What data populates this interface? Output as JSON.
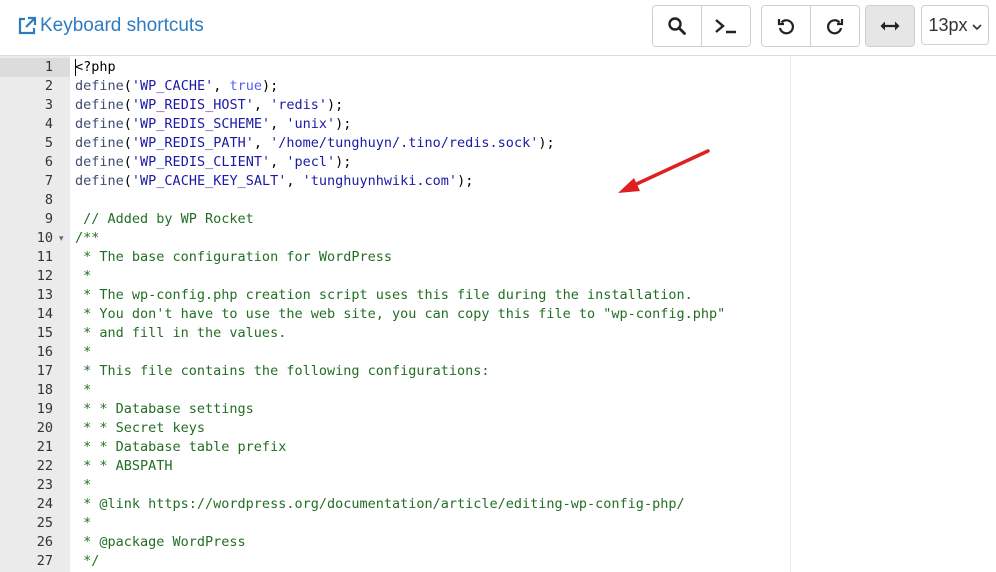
{
  "toolbar": {
    "keyboard_shortcuts_label": "Keyboard shortcuts",
    "font_size_value": "13px",
    "buttons": [
      "search-icon",
      "terminal-icon",
      "undo-icon",
      "redo-icon",
      "wrap-toggle-icon"
    ]
  },
  "colors": {
    "link": "#2e7bbf",
    "gutter_bg": "#ebebeb",
    "active_line_bg": "#dcdcdc",
    "string": "#1a1aa6",
    "comment": "#236e24",
    "constant": "#585cf6",
    "arrow": "#e02020"
  },
  "editor": {
    "line_numbers": [
      "1",
      "2",
      "3",
      "4",
      "5",
      "6",
      "7",
      "8",
      "9",
      "10",
      "11",
      "12",
      "13",
      "14",
      "15",
      "16",
      "17",
      "18",
      "19",
      "20",
      "21",
      "22",
      "23",
      "24",
      "25",
      "26",
      "27"
    ],
    "fold_marker": "▾",
    "lines": [
      {
        "segments": [
          {
            "t": "<?php",
            "c": "kw"
          }
        ]
      },
      {
        "segments": [
          {
            "t": "define",
            "c": "fn"
          },
          {
            "t": "(",
            "c": "kw"
          },
          {
            "t": "'WP_CACHE'",
            "c": "str"
          },
          {
            "t": ", ",
            "c": "kw"
          },
          {
            "t": "true",
            "c": "const"
          },
          {
            "t": ");",
            "c": "kw"
          }
        ]
      },
      {
        "segments": [
          {
            "t": "define",
            "c": "fn"
          },
          {
            "t": "(",
            "c": "kw"
          },
          {
            "t": "'WP_REDIS_HOST'",
            "c": "str"
          },
          {
            "t": ", ",
            "c": "kw"
          },
          {
            "t": "'redis'",
            "c": "str"
          },
          {
            "t": ");",
            "c": "kw"
          }
        ]
      },
      {
        "segments": [
          {
            "t": "define",
            "c": "fn"
          },
          {
            "t": "(",
            "c": "kw"
          },
          {
            "t": "'WP_REDIS_SCHEME'",
            "c": "str"
          },
          {
            "t": ", ",
            "c": "kw"
          },
          {
            "t": "'unix'",
            "c": "str"
          },
          {
            "t": ");",
            "c": "kw"
          }
        ]
      },
      {
        "segments": [
          {
            "t": "define",
            "c": "fn"
          },
          {
            "t": "(",
            "c": "kw"
          },
          {
            "t": "'WP_REDIS_PATH'",
            "c": "str"
          },
          {
            "t": ", ",
            "c": "kw"
          },
          {
            "t": "'/home/tunghuyn/.tino/redis.sock'",
            "c": "str"
          },
          {
            "t": ");",
            "c": "kw"
          }
        ]
      },
      {
        "segments": [
          {
            "t": "define",
            "c": "fn"
          },
          {
            "t": "(",
            "c": "kw"
          },
          {
            "t": "'WP_REDIS_CLIENT'",
            "c": "str"
          },
          {
            "t": ", ",
            "c": "kw"
          },
          {
            "t": "'pecl'",
            "c": "str"
          },
          {
            "t": ");",
            "c": "kw"
          }
        ]
      },
      {
        "segments": [
          {
            "t": "define",
            "c": "fn"
          },
          {
            "t": "(",
            "c": "kw"
          },
          {
            "t": "'WP_CACHE_KEY_SALT'",
            "c": "str"
          },
          {
            "t": ", ",
            "c": "kw"
          },
          {
            "t": "'tunghuynhwiki.com'",
            "c": "str"
          },
          {
            "t": ");",
            "c": "kw"
          }
        ]
      },
      {
        "segments": []
      },
      {
        "segments": [
          {
            "t": " // Added by WP Rocket",
            "c": "cm"
          }
        ]
      },
      {
        "segments": [
          {
            "t": "/**",
            "c": "cm"
          }
        ]
      },
      {
        "segments": [
          {
            "t": " * The base configuration for WordPress",
            "c": "cm"
          }
        ]
      },
      {
        "segments": [
          {
            "t": " *",
            "c": "cm"
          }
        ]
      },
      {
        "segments": [
          {
            "t": " * The wp-config.php creation script uses this file during the installation.",
            "c": "cm"
          }
        ]
      },
      {
        "segments": [
          {
            "t": " * You don't have to use the web site, you can copy this file to \"wp-config.php\"",
            "c": "cm"
          }
        ]
      },
      {
        "segments": [
          {
            "t": " * and fill in the values.",
            "c": "cm"
          }
        ]
      },
      {
        "segments": [
          {
            "t": " *",
            "c": "cm"
          }
        ]
      },
      {
        "segments": [
          {
            "t": " * This file contains the following configurations:",
            "c": "cm"
          }
        ]
      },
      {
        "segments": [
          {
            "t": " *",
            "c": "cm"
          }
        ]
      },
      {
        "segments": [
          {
            "t": " * * Database settings",
            "c": "cm"
          }
        ]
      },
      {
        "segments": [
          {
            "t": " * * Secret keys",
            "c": "cm"
          }
        ]
      },
      {
        "segments": [
          {
            "t": " * * Database table prefix",
            "c": "cm"
          }
        ]
      },
      {
        "segments": [
          {
            "t": " * * ABSPATH",
            "c": "cm"
          }
        ]
      },
      {
        "segments": [
          {
            "t": " *",
            "c": "cm"
          }
        ]
      },
      {
        "segments": [
          {
            "t": " * @link https://wordpress.org/documentation/article/editing-wp-config-php/",
            "c": "cm"
          }
        ]
      },
      {
        "segments": [
          {
            "t": " *",
            "c": "cm"
          }
        ]
      },
      {
        "segments": [
          {
            "t": " * @package WordPress",
            "c": "cm"
          }
        ]
      },
      {
        "segments": [
          {
            "t": " */",
            "c": "cm"
          }
        ]
      }
    ]
  }
}
